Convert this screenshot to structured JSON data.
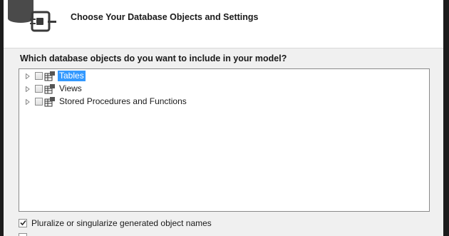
{
  "header": {
    "title": "Choose Your Database Objects and Settings",
    "icon": "database-plug-icon"
  },
  "question": "Which database objects do you want to include in your model?",
  "tree": {
    "items": [
      {
        "label": "Tables",
        "checked": false,
        "selected": true,
        "icon": "table-icon"
      },
      {
        "label": "Views",
        "checked": false,
        "selected": false,
        "icon": "view-icon"
      },
      {
        "label": "Stored Procedures and Functions",
        "checked": false,
        "selected": false,
        "icon": "procedure-icon"
      }
    ]
  },
  "options": [
    {
      "label": "Pluralize or singularize generated object names",
      "checked": true
    }
  ],
  "colors": {
    "selection": "#3399ff",
    "dialog_background": "#f0f0f0",
    "header_background": "#ffffff"
  }
}
